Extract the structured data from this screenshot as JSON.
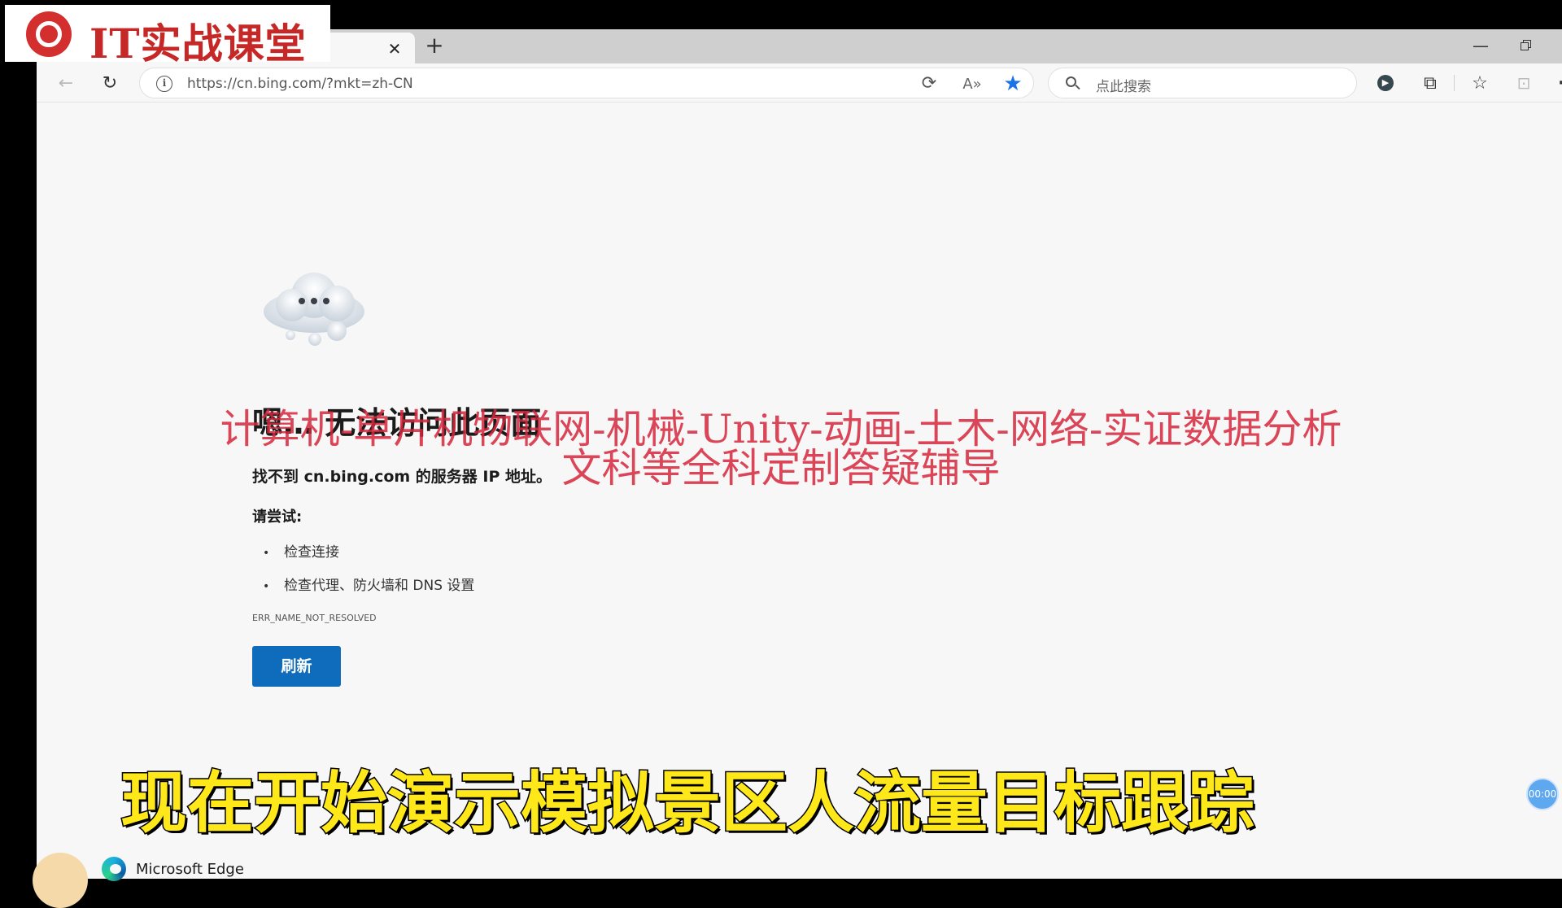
{
  "branding": {
    "overlay_title": "IT实战课堂",
    "icon": "chrome-like-logo-icon"
  },
  "tab_bar": {
    "close_icon": "close-icon",
    "new_tab_icon": "plus-icon",
    "close_glyph": "✕",
    "new_tab_glyph": "+",
    "minimize_glyph": "—"
  },
  "toolbar": {
    "back_glyph": "←",
    "reload_glyph": "↻",
    "address": {
      "url": "https://cn.bing.com/?mkt=zh-CN",
      "info_glyph": "i"
    },
    "read_aloud_glyph": "A»",
    "favorite_glyph": "★",
    "search": {
      "placeholder": "点此搜索"
    },
    "copilot_glyph": "▶",
    "extensions_glyph": "⧉",
    "favorites_glyph": "☆",
    "collections_glyph": "⊡",
    "more_glyph": "···"
  },
  "error_page": {
    "title": "嗯… 无法访问此页面",
    "description": "找不到 cn.bing.com 的服务器 IP 地址。",
    "try_label": "请尝试:",
    "suggestions": [
      "检查连接",
      "检查代理、防火墙和 DNS 设置"
    ],
    "error_code": "ERR_NAME_NOT_RESOLVED",
    "refresh_label": "刷新",
    "brand_name": "Microsoft Edge"
  },
  "watermark": {
    "line1": "计算机-单片机物联网-机械-Unity-动画-土木-网络-实证数据分析",
    "line2": "文科等全科定制答疑辅导"
  },
  "subtitle": "现在开始演示模拟景区人流量目标跟踪",
  "timer": "00:00",
  "colors": {
    "accent": "#0f6cbd",
    "favorite_star": "#1a73e8",
    "watermark": "#d6263c",
    "subtitle": "#ffe81a",
    "logo_red": "#c62828"
  }
}
